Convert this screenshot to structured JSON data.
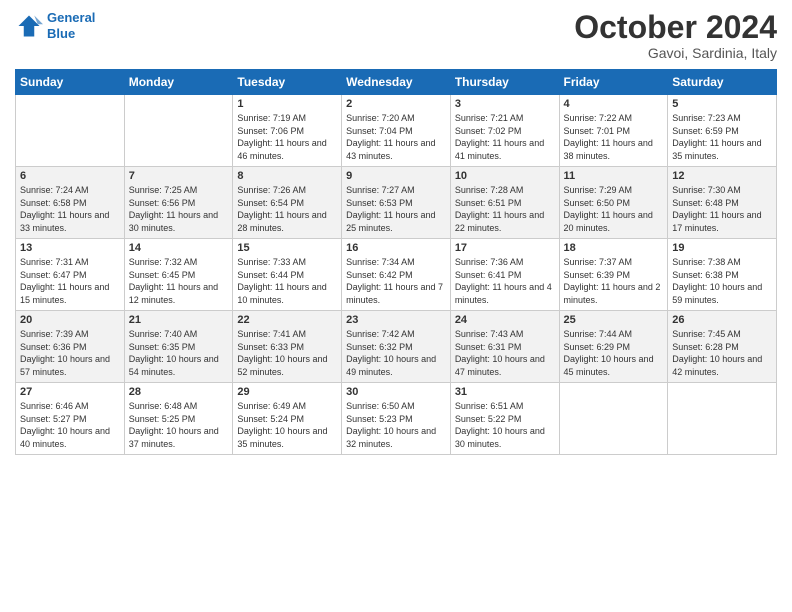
{
  "header": {
    "logo_line1": "General",
    "logo_line2": "Blue",
    "month": "October 2024",
    "location": "Gavoi, Sardinia, Italy"
  },
  "days_of_week": [
    "Sunday",
    "Monday",
    "Tuesday",
    "Wednesday",
    "Thursday",
    "Friday",
    "Saturday"
  ],
  "weeks": [
    [
      {
        "day": "",
        "sunrise": "",
        "sunset": "",
        "daylight": ""
      },
      {
        "day": "",
        "sunrise": "",
        "sunset": "",
        "daylight": ""
      },
      {
        "day": "1",
        "sunrise": "Sunrise: 7:19 AM",
        "sunset": "Sunset: 7:06 PM",
        "daylight": "Daylight: 11 hours and 46 minutes."
      },
      {
        "day": "2",
        "sunrise": "Sunrise: 7:20 AM",
        "sunset": "Sunset: 7:04 PM",
        "daylight": "Daylight: 11 hours and 43 minutes."
      },
      {
        "day": "3",
        "sunrise": "Sunrise: 7:21 AM",
        "sunset": "Sunset: 7:02 PM",
        "daylight": "Daylight: 11 hours and 41 minutes."
      },
      {
        "day": "4",
        "sunrise": "Sunrise: 7:22 AM",
        "sunset": "Sunset: 7:01 PM",
        "daylight": "Daylight: 11 hours and 38 minutes."
      },
      {
        "day": "5",
        "sunrise": "Sunrise: 7:23 AM",
        "sunset": "Sunset: 6:59 PM",
        "daylight": "Daylight: 11 hours and 35 minutes."
      }
    ],
    [
      {
        "day": "6",
        "sunrise": "Sunrise: 7:24 AM",
        "sunset": "Sunset: 6:58 PM",
        "daylight": "Daylight: 11 hours and 33 minutes."
      },
      {
        "day": "7",
        "sunrise": "Sunrise: 7:25 AM",
        "sunset": "Sunset: 6:56 PM",
        "daylight": "Daylight: 11 hours and 30 minutes."
      },
      {
        "day": "8",
        "sunrise": "Sunrise: 7:26 AM",
        "sunset": "Sunset: 6:54 PM",
        "daylight": "Daylight: 11 hours and 28 minutes."
      },
      {
        "day": "9",
        "sunrise": "Sunrise: 7:27 AM",
        "sunset": "Sunset: 6:53 PM",
        "daylight": "Daylight: 11 hours and 25 minutes."
      },
      {
        "day": "10",
        "sunrise": "Sunrise: 7:28 AM",
        "sunset": "Sunset: 6:51 PM",
        "daylight": "Daylight: 11 hours and 22 minutes."
      },
      {
        "day": "11",
        "sunrise": "Sunrise: 7:29 AM",
        "sunset": "Sunset: 6:50 PM",
        "daylight": "Daylight: 11 hours and 20 minutes."
      },
      {
        "day": "12",
        "sunrise": "Sunrise: 7:30 AM",
        "sunset": "Sunset: 6:48 PM",
        "daylight": "Daylight: 11 hours and 17 minutes."
      }
    ],
    [
      {
        "day": "13",
        "sunrise": "Sunrise: 7:31 AM",
        "sunset": "Sunset: 6:47 PM",
        "daylight": "Daylight: 11 hours and 15 minutes."
      },
      {
        "day": "14",
        "sunrise": "Sunrise: 7:32 AM",
        "sunset": "Sunset: 6:45 PM",
        "daylight": "Daylight: 11 hours and 12 minutes."
      },
      {
        "day": "15",
        "sunrise": "Sunrise: 7:33 AM",
        "sunset": "Sunset: 6:44 PM",
        "daylight": "Daylight: 11 hours and 10 minutes."
      },
      {
        "day": "16",
        "sunrise": "Sunrise: 7:34 AM",
        "sunset": "Sunset: 6:42 PM",
        "daylight": "Daylight: 11 hours and 7 minutes."
      },
      {
        "day": "17",
        "sunrise": "Sunrise: 7:36 AM",
        "sunset": "Sunset: 6:41 PM",
        "daylight": "Daylight: 11 hours and 4 minutes."
      },
      {
        "day": "18",
        "sunrise": "Sunrise: 7:37 AM",
        "sunset": "Sunset: 6:39 PM",
        "daylight": "Daylight: 11 hours and 2 minutes."
      },
      {
        "day": "19",
        "sunrise": "Sunrise: 7:38 AM",
        "sunset": "Sunset: 6:38 PM",
        "daylight": "Daylight: 10 hours and 59 minutes."
      }
    ],
    [
      {
        "day": "20",
        "sunrise": "Sunrise: 7:39 AM",
        "sunset": "Sunset: 6:36 PM",
        "daylight": "Daylight: 10 hours and 57 minutes."
      },
      {
        "day": "21",
        "sunrise": "Sunrise: 7:40 AM",
        "sunset": "Sunset: 6:35 PM",
        "daylight": "Daylight: 10 hours and 54 minutes."
      },
      {
        "day": "22",
        "sunrise": "Sunrise: 7:41 AM",
        "sunset": "Sunset: 6:33 PM",
        "daylight": "Daylight: 10 hours and 52 minutes."
      },
      {
        "day": "23",
        "sunrise": "Sunrise: 7:42 AM",
        "sunset": "Sunset: 6:32 PM",
        "daylight": "Daylight: 10 hours and 49 minutes."
      },
      {
        "day": "24",
        "sunrise": "Sunrise: 7:43 AM",
        "sunset": "Sunset: 6:31 PM",
        "daylight": "Daylight: 10 hours and 47 minutes."
      },
      {
        "day": "25",
        "sunrise": "Sunrise: 7:44 AM",
        "sunset": "Sunset: 6:29 PM",
        "daylight": "Daylight: 10 hours and 45 minutes."
      },
      {
        "day": "26",
        "sunrise": "Sunrise: 7:45 AM",
        "sunset": "Sunset: 6:28 PM",
        "daylight": "Daylight: 10 hours and 42 minutes."
      }
    ],
    [
      {
        "day": "27",
        "sunrise": "Sunrise: 6:46 AM",
        "sunset": "Sunset: 5:27 PM",
        "daylight": "Daylight: 10 hours and 40 minutes."
      },
      {
        "day": "28",
        "sunrise": "Sunrise: 6:48 AM",
        "sunset": "Sunset: 5:25 PM",
        "daylight": "Daylight: 10 hours and 37 minutes."
      },
      {
        "day": "29",
        "sunrise": "Sunrise: 6:49 AM",
        "sunset": "Sunset: 5:24 PM",
        "daylight": "Daylight: 10 hours and 35 minutes."
      },
      {
        "day": "30",
        "sunrise": "Sunrise: 6:50 AM",
        "sunset": "Sunset: 5:23 PM",
        "daylight": "Daylight: 10 hours and 32 minutes."
      },
      {
        "day": "31",
        "sunrise": "Sunrise: 6:51 AM",
        "sunset": "Sunset: 5:22 PM",
        "daylight": "Daylight: 10 hours and 30 minutes."
      },
      {
        "day": "",
        "sunrise": "",
        "sunset": "",
        "daylight": ""
      },
      {
        "day": "",
        "sunrise": "",
        "sunset": "",
        "daylight": ""
      }
    ]
  ]
}
